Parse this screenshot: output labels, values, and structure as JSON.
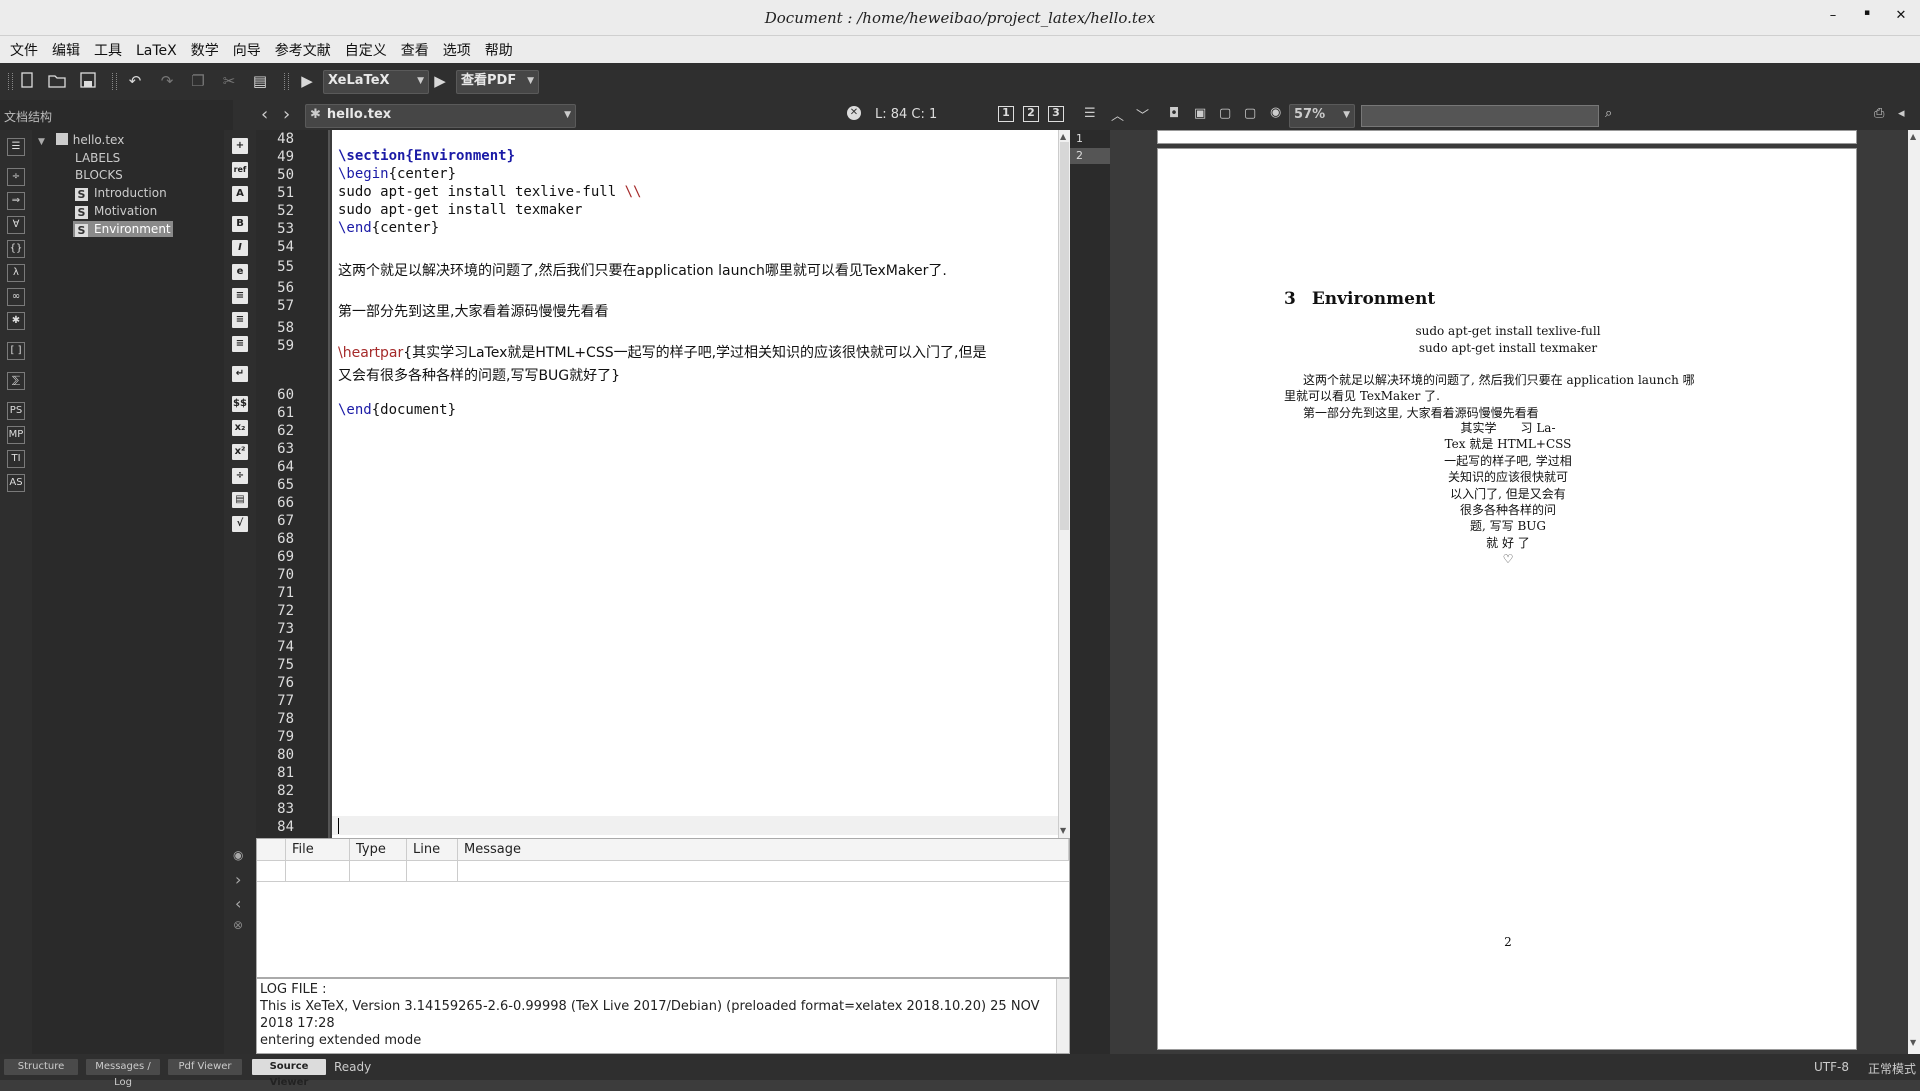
{
  "window": {
    "title": "Document : /home/heweibao/project_latex/hello.tex",
    "minimize": "–",
    "maximize": "▪",
    "close": "✕"
  },
  "menu": [
    "文件",
    "编辑",
    "工具",
    "LaTeX",
    "数学",
    "向导",
    "参考文献",
    "自定义",
    "查看",
    "选项",
    "帮助"
  ],
  "toolbar": {
    "compiler": "XeLaTeX",
    "viewer": "查看PDF"
  },
  "structure": {
    "header": "文档结构",
    "file": "hello.tex",
    "labels": "LABELS",
    "blocks": "BLOCKS",
    "sections": [
      {
        "badge": "S",
        "label": "Introduction"
      },
      {
        "badge": "S",
        "label": "Motivation"
      },
      {
        "badge": "S",
        "label": "Environment"
      }
    ]
  },
  "editor": {
    "tab": "hello.tex",
    "position": "L: 84 C: 1",
    "lines": {
      "l48": "",
      "l49": "\\section{Environment}",
      "l50": "\\begin{center}",
      "l51a": "sudo apt-get install texlive-full ",
      "l51b": "\\\\",
      "l52": "sudo apt-get install texmaker",
      "l53": "\\end{center}",
      "l55": "这两个就足以解决环境的问题了,然后我们只要在application launch哪里就可以看见TexMaker了.",
      "l57": "第一部分先到这里,大家看着源码慢慢先看看",
      "l59a": "\\heartpar",
      "l59b": "{其实学习LaTex就是HTML+CSS一起写的样子吧,学过相关知识的应该很快就可以入门了,但是",
      "l59c": "又会有很多各种各样的问题,写写BUG就好了}",
      "l61": "\\end{document}"
    }
  },
  "messages": {
    "columns": [
      "File",
      "Type",
      "Line",
      "Message"
    ],
    "log": [
      "LOG FILE :",
      "This is XeTeX, Version 3.14159265-2.6-0.99998 (TeX Live 2017/Debian) (preloaded format=xelatex 2018.10.20) 25 NOV",
      "2018 17:28",
      "entering extended mode"
    ]
  },
  "pdf": {
    "zoom": "57%",
    "pages": [
      "1",
      "2"
    ],
    "section_num": "3",
    "section_title": "Environment",
    "center1": "sudo apt-get install texlive-full",
    "center2": "sudo apt-get install texmaker",
    "para1a": "这两个就足以解决环境的问题了, 然后我们只要在 application launch 哪",
    "para1b": "里就可以看见 TexMaker 了.",
    "para2": "第一部分先到这里, 大家看着源码慢慢先看看",
    "heart": [
      "其实学　　习 La-",
      "Tex 就是 HTML+CSS",
      "一起写的样子吧, 学过相",
      "关知识的应该很快就可",
      "以入门了, 但是又会有",
      "很多各种各样的问",
      "题, 写写 BUG",
      "就 好 了",
      "♡"
    ],
    "page_number": "2"
  },
  "statusbar": {
    "buttons": [
      "Structure",
      "Messages / Log",
      "Pdf Viewer",
      "Source Viewer"
    ],
    "status": "Ready",
    "encoding": "UTF-8",
    "mode": "正常模式"
  }
}
